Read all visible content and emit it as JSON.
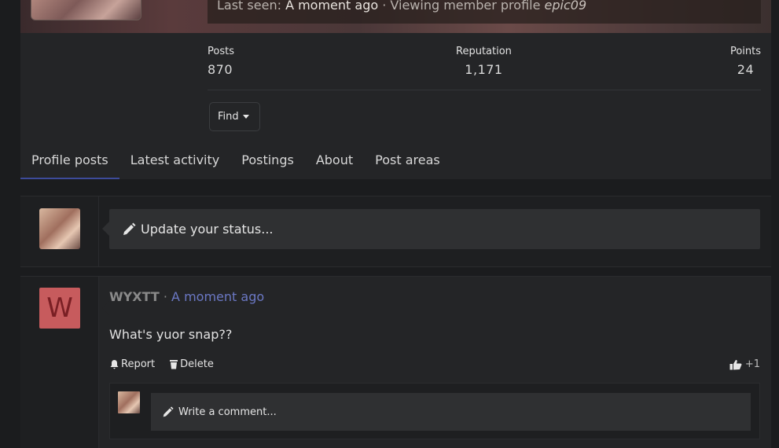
{
  "header": {
    "last_seen_label": "Last seen:",
    "last_seen_time": "A moment ago",
    "activity_prefix": "· Viewing member profile",
    "activity_target": "epic09"
  },
  "stats": [
    {
      "label": "Posts",
      "value": "870"
    },
    {
      "label": "Reputation",
      "value": "1,171"
    },
    {
      "label": "Points",
      "value": "24"
    }
  ],
  "find_button": {
    "label": "Find"
  },
  "tabs": [
    {
      "label": "Profile posts",
      "active": true
    },
    {
      "label": "Latest activity",
      "active": false
    },
    {
      "label": "Postings",
      "active": false
    },
    {
      "label": "About",
      "active": false
    },
    {
      "label": "Post areas",
      "active": false
    }
  ],
  "status": {
    "placeholder": "Update your status..."
  },
  "post": {
    "avatar_letter": "W",
    "avatar_color": "#c75b5d",
    "author": "WYXTT",
    "separator": "·",
    "time": "A moment ago",
    "text": "What's yuor snap??",
    "actions": [
      {
        "label": "Report",
        "icon": "bell-icon"
      },
      {
        "label": "Delete",
        "icon": "trash-icon"
      }
    ],
    "like_count": "+1",
    "comment_placeholder": "Write a comment..."
  },
  "colors": {
    "accent": "#3d4b9a",
    "link": "#6b78c4",
    "background": "#1b1c1e"
  }
}
